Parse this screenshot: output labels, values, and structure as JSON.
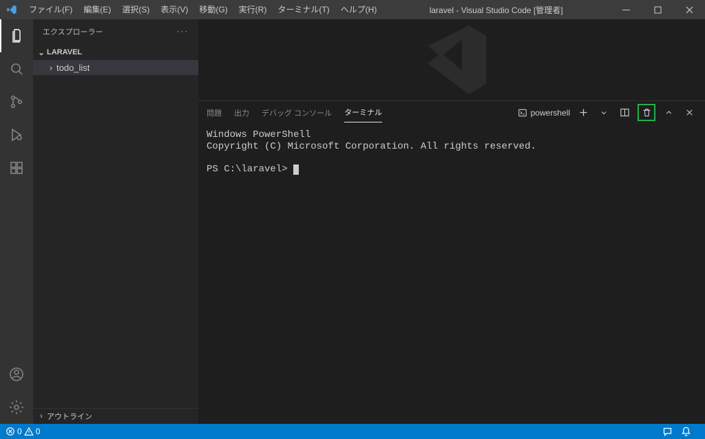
{
  "menu": {
    "file": "ファイル(F)",
    "edit": "編集(E)",
    "selection": "選択(S)",
    "view": "表示(V)",
    "go": "移動(G)",
    "run": "実行(R)",
    "terminal": "ターミナル(T)",
    "help": "ヘルプ(H)"
  },
  "title": "laravel - Visual Studio Code [管理者]",
  "sidebar": {
    "title": "エクスプローラー",
    "project_name": "LARAVEL",
    "items": [
      {
        "label": "todo_list"
      }
    ],
    "outline_label": "アウトライン"
  },
  "panel": {
    "tabs": {
      "problems": "問題",
      "output": "出力",
      "debug_console": "デバッグ コンソール",
      "terminal": "ターミナル"
    },
    "shell_label": "powershell"
  },
  "terminal": {
    "line1": "Windows PowerShell",
    "line2": "Copyright (C) Microsoft Corporation. All rights reserved.",
    "prompt": "PS C:\\laravel> "
  },
  "status": {
    "errors": "0",
    "warnings": "0"
  }
}
